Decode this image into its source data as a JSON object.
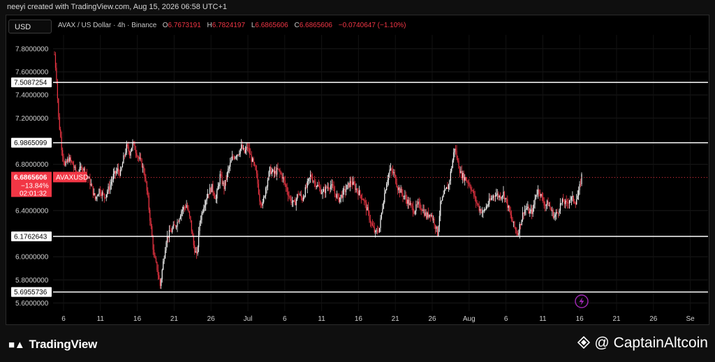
{
  "header": {
    "attribution": "neeyi created with TradingView.com, Aug 15, 2026 06:58 UTC+1"
  },
  "toolbar": {
    "currency": "USD"
  },
  "ohlc": {
    "symbol": "AVAX / US Dollar · 4h · Binance",
    "open_label": "O",
    "open": "6.7673191",
    "high_label": "H",
    "high": "6.7824197",
    "low_label": "L",
    "low": "6.6865606",
    "close_label": "C",
    "close": "6.6865606",
    "change": "−0.0740647 (−1.10%)"
  },
  "footer": {
    "brand": "TradingView",
    "credit": "@ CaptainAltcoin"
  },
  "colors": {
    "up": "#ffffff",
    "down": "#f23645",
    "level_line": "#ffffff",
    "grid": "#1a1a1a"
  },
  "chart_data": {
    "type": "candlestick",
    "y_axis_ticks": [
      "7.8000000",
      "7.6000000",
      "7.4000000",
      "7.2000000",
      "6.8000000",
      "6.4000000",
      "6.0000000",
      "5.8000000",
      "5.6000000"
    ],
    "x_axis_ticks": [
      "6",
      "11",
      "16",
      "21",
      "26",
      "Jul",
      "6",
      "11",
      "16",
      "21",
      "26",
      "Aug",
      "6",
      "11",
      "16",
      "21",
      "26",
      "Se"
    ],
    "ylim": [
      5.53,
      7.92
    ],
    "horizontal_levels": [
      {
        "value": 7.5087254,
        "label": "7.5087254"
      },
      {
        "value": 6.9865099,
        "label": "6.9865099"
      },
      {
        "value": 6.1762643,
        "label": "6.1762643"
      },
      {
        "value": 5.6955736,
        "label": "5.6955736"
      }
    ],
    "current_price": {
      "value": 6.6865606,
      "label": "6.6865606",
      "symbol": "AVAXUSD",
      "change": "−13.84%",
      "countdown": "02:01:32"
    },
    "series_path": [
      [
        0,
        7.75
      ],
      [
        2,
        7.55
      ],
      [
        4,
        7.2
      ],
      [
        7,
        6.95
      ],
      [
        10,
        6.78
      ],
      [
        14,
        6.85
      ],
      [
        18,
        6.8
      ],
      [
        22,
        6.7
      ],
      [
        27,
        6.78
      ],
      [
        31,
        6.72
      ],
      [
        36,
        6.62
      ],
      [
        40,
        6.5
      ],
      [
        44,
        6.58
      ],
      [
        49,
        6.52
      ],
      [
        54,
        6.6
      ],
      [
        58,
        6.7
      ],
      [
        62,
        6.75
      ],
      [
        65,
        6.72
      ],
      [
        68,
        6.85
      ],
      [
        71,
        6.95
      ],
      [
        74,
        6.9
      ],
      [
        77,
        6.98
      ],
      [
        80,
        6.92
      ],
      [
        83,
        6.85
      ],
      [
        86,
        6.8
      ],
      [
        89,
        6.7
      ],
      [
        92,
        6.5
      ],
      [
        95,
        6.25
      ],
      [
        98,
        6.0
      ],
      [
        101,
        5.9
      ],
      [
        104,
        5.75
      ],
      [
        107,
        5.95
      ],
      [
        110,
        6.15
      ],
      [
        113,
        6.2
      ],
      [
        117,
        6.25
      ],
      [
        121,
        6.3
      ],
      [
        125,
        6.4
      ],
      [
        130,
        6.45
      ],
      [
        134,
        6.3
      ],
      [
        137,
        6.1
      ],
      [
        140,
        6.0
      ],
      [
        143,
        6.3
      ],
      [
        147,
        6.45
      ],
      [
        151,
        6.55
      ],
      [
        155,
        6.6
      ],
      [
        159,
        6.5
      ],
      [
        163,
        6.7
      ],
      [
        167,
        6.6
      ],
      [
        171,
        6.75
      ],
      [
        175,
        6.85
      ],
      [
        178,
        6.88
      ],
      [
        181,
        6.9
      ],
      [
        184,
        6.95
      ],
      [
        187,
        6.9
      ],
      [
        190,
        6.95
      ],
      [
        193,
        6.87
      ],
      [
        196,
        6.8
      ],
      [
        199,
        6.7
      ],
      [
        202,
        6.5
      ],
      [
        205,
        6.45
      ],
      [
        208,
        6.6
      ],
      [
        212,
        6.75
      ],
      [
        216,
        6.72
      ],
      [
        220,
        6.75
      ],
      [
        224,
        6.7
      ],
      [
        228,
        6.6
      ],
      [
        232,
        6.5
      ],
      [
        236,
        6.45
      ],
      [
        240,
        6.55
      ],
      [
        244,
        6.5
      ],
      [
        248,
        6.6
      ],
      [
        252,
        6.7
      ],
      [
        256,
        6.65
      ],
      [
        260,
        6.6
      ],
      [
        264,
        6.55
      ],
      [
        268,
        6.6
      ],
      [
        272,
        6.62
      ],
      [
        276,
        6.55
      ],
      [
        280,
        6.5
      ],
      [
        284,
        6.55
      ],
      [
        288,
        6.6
      ],
      [
        292,
        6.65
      ],
      [
        296,
        6.6
      ],
      [
        300,
        6.55
      ],
      [
        304,
        6.5
      ],
      [
        308,
        6.4
      ],
      [
        312,
        6.28
      ],
      [
        316,
        6.2
      ],
      [
        320,
        6.25
      ],
      [
        324,
        6.5
      ],
      [
        327,
        6.65
      ],
      [
        330,
        6.75
      ],
      [
        334,
        6.72
      ],
      [
        338,
        6.6
      ],
      [
        342,
        6.55
      ],
      [
        346,
        6.5
      ],
      [
        350,
        6.45
      ],
      [
        354,
        6.4
      ],
      [
        358,
        6.45
      ],
      [
        362,
        6.42
      ],
      [
        366,
        6.35
      ],
      [
        370,
        6.38
      ],
      [
        374,
        6.3
      ],
      [
        377,
        6.2
      ],
      [
        380,
        6.45
      ],
      [
        384,
        6.55
      ],
      [
        388,
        6.62
      ],
      [
        391,
        6.78
      ],
      [
        394,
        6.95
      ],
      [
        397,
        6.82
      ],
      [
        400,
        6.72
      ],
      [
        404,
        6.68
      ],
      [
        407,
        6.65
      ],
      [
        410,
        6.6
      ],
      [
        414,
        6.5
      ],
      [
        418,
        6.42
      ],
      [
        422,
        6.38
      ],
      [
        426,
        6.45
      ],
      [
        430,
        6.5
      ],
      [
        434,
        6.55
      ],
      [
        438,
        6.52
      ],
      [
        442,
        6.55
      ],
      [
        445,
        6.48
      ],
      [
        449,
        6.35
      ],
      [
        453,
        6.25
      ],
      [
        456,
        6.2
      ],
      [
        459,
        6.3
      ],
      [
        462,
        6.4
      ],
      [
        465,
        6.42
      ],
      [
        468,
        6.38
      ],
      [
        471,
        6.4
      ],
      [
        474,
        6.55
      ],
      [
        477,
        6.58
      ],
      [
        480,
        6.5
      ],
      [
        483,
        6.45
      ],
      [
        486,
        6.46
      ],
      [
        489,
        6.4
      ],
      [
        492,
        6.35
      ],
      [
        495,
        6.38
      ],
      [
        498,
        6.45
      ],
      [
        501,
        6.48
      ],
      [
        504,
        6.45
      ],
      [
        507,
        6.5
      ],
      [
        510,
        6.5
      ],
      [
        513,
        6.48
      ],
      [
        516,
        6.55
      ],
      [
        519,
        6.7
      ]
    ]
  }
}
